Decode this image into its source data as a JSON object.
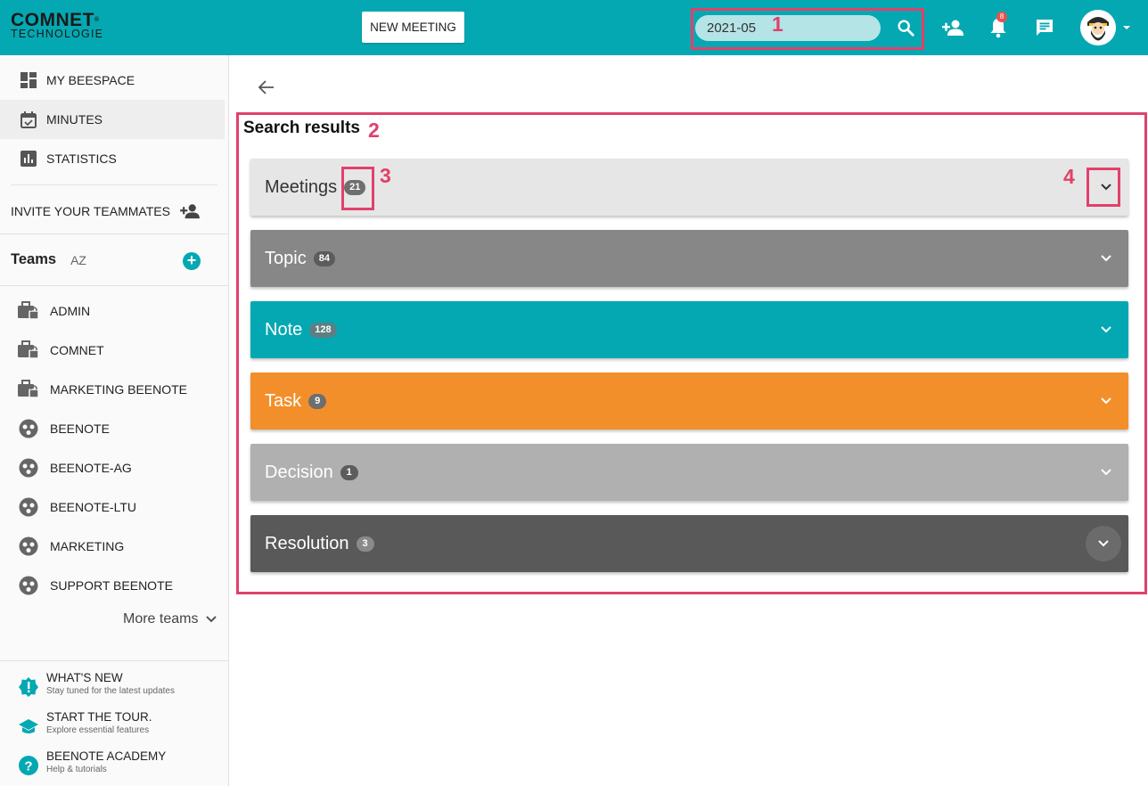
{
  "header": {
    "logo_line1": "COMNET",
    "logo_reg": "®",
    "logo_line2": "TECHNOLOGIE",
    "new_meeting_label": "NEW MEETING",
    "search_value": "2021-05",
    "notification_count": "8",
    "accent_color": "#04a8b2"
  },
  "sidebar": {
    "nav": [
      {
        "label": "MY BEESPACE",
        "icon": "dashboard-icon"
      },
      {
        "label": "MINUTES",
        "icon": "calendar-check-icon"
      },
      {
        "label": "STATISTICS",
        "icon": "bar-chart-icon"
      }
    ],
    "invite_label": "INVITE YOUR TEAMMATES",
    "teams_title": "Teams",
    "sort_label": "AZ",
    "teams": [
      {
        "label": "ADMIN",
        "icon": "locked-briefcase-icon"
      },
      {
        "label": "COMNET",
        "icon": "locked-briefcase-icon"
      },
      {
        "label": "MARKETING BEENOTE",
        "icon": "locked-briefcase-icon"
      },
      {
        "label": "BEENOTE",
        "icon": "team-circle-icon"
      },
      {
        "label": "BEENOTE-AG",
        "icon": "team-circle-icon"
      },
      {
        "label": "BEENOTE-LTU",
        "icon": "team-circle-icon"
      },
      {
        "label": "MARKETING",
        "icon": "team-circle-icon"
      },
      {
        "label": "SUPPORT BEENOTE",
        "icon": "team-circle-icon"
      }
    ],
    "more_teams_label": "More teams",
    "bottom": [
      {
        "title": "WHAT'S NEW",
        "subtitle": "Stay tuned for the latest updates",
        "icon": "alert-badge-icon"
      },
      {
        "title": "START THE TOUR.",
        "subtitle": "Explore essential features",
        "icon": "graduation-cap-icon"
      },
      {
        "title": "BEENOTE ACADEMY",
        "subtitle": "Help & tutorials",
        "icon": "help-circle-icon"
      }
    ]
  },
  "main": {
    "results_title": "Search results",
    "annotations": [
      "1",
      "2",
      "3",
      "4"
    ],
    "panels": [
      {
        "label": "Meetings",
        "count": "21",
        "bg": "#e6e6e6",
        "fg": "#333333",
        "badge_bg": "#6e6e6e"
      },
      {
        "label": "Topic",
        "count": "84",
        "bg": "#878787",
        "fg": "#ffffff",
        "badge_bg": "#5c5c5c"
      },
      {
        "label": "Note",
        "count": "128",
        "bg": "#04a8b2",
        "fg": "#ffffff",
        "badge_bg": "#5e7f82"
      },
      {
        "label": "Task",
        "count": "9",
        "bg": "#f38f2a",
        "fg": "#ffffff",
        "badge_bg": "#6e6e6e"
      },
      {
        "label": "Decision",
        "count": "1",
        "bg": "#b0b0b0",
        "fg": "#ffffff",
        "badge_bg": "#5c5c5c"
      },
      {
        "label": "Resolution",
        "count": "3",
        "bg": "#595959",
        "fg": "#ffffff",
        "badge_bg": "#8a8a8a"
      }
    ]
  }
}
